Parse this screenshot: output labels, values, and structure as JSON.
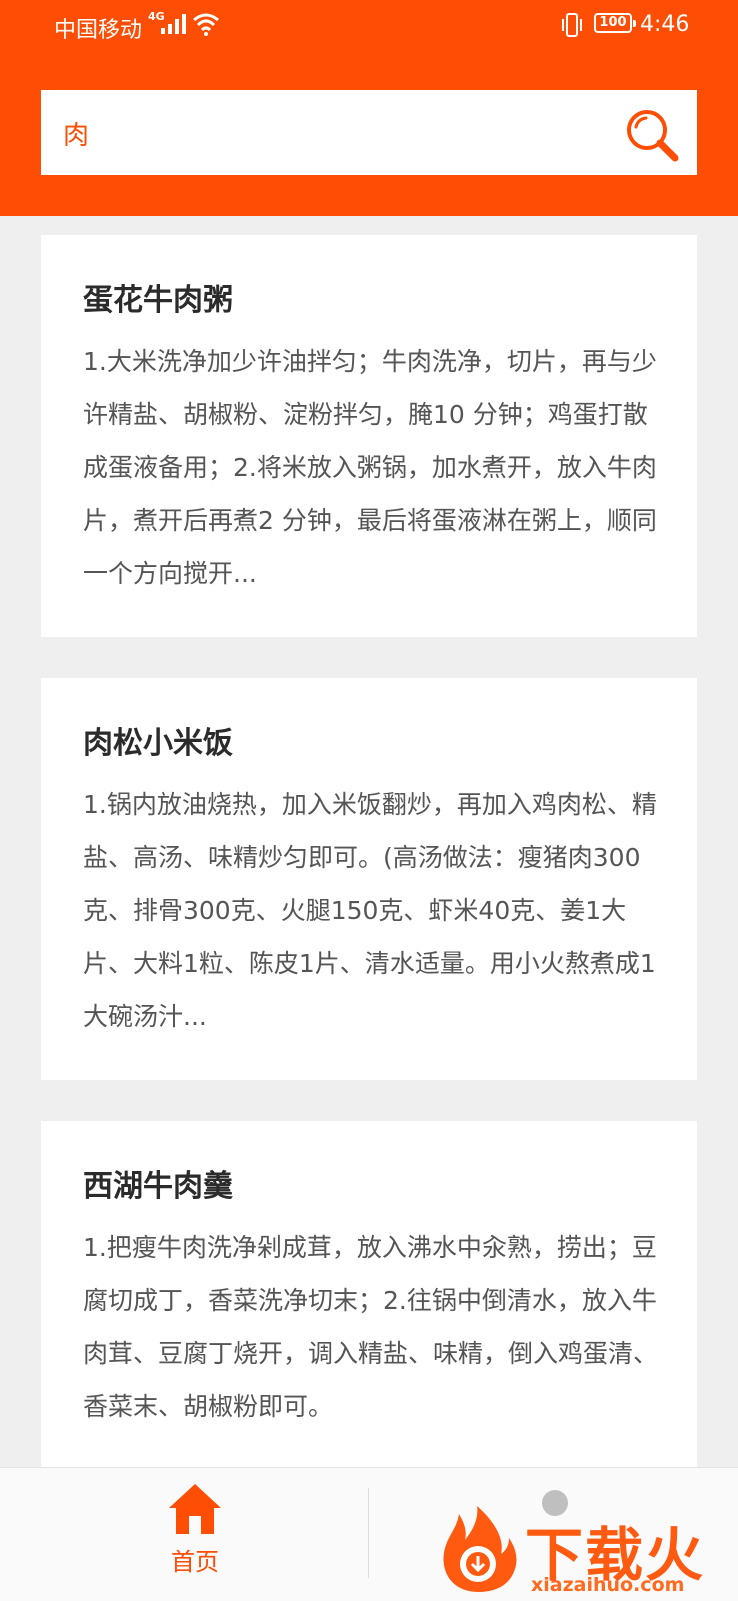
{
  "status_bar": {
    "carrier": "中国移动",
    "network": "4G",
    "battery": "100",
    "time": "4:46"
  },
  "search": {
    "query": "肉"
  },
  "results": [
    {
      "title": "蛋花牛肉粥",
      "summary": "1.大米洗净加少许油拌匀；牛肉洗净，切片，再与少许精盐、胡椒粉、淀粉拌匀，腌10 分钟；鸡蛋打散成蛋液备用；2.将米放入粥锅，加水煮开，放入牛肉片，煮开后再煮2 分钟，最后将蛋液淋在粥上，顺同一个方向搅开..."
    },
    {
      "title": "肉松小米饭",
      "summary": "1.锅内放油烧热，加入米饭翻炒，再加入鸡肉松、精盐、高汤、味精炒匀即可。(高汤做法：瘦猪肉300克、排骨300克、火腿150克、虾米40克、姜1大片、大料1粒、陈皮1片、清水适量。用小火熬煮成1大碗汤汁..."
    },
    {
      "title": "西湖牛肉羹",
      "summary": "1.把瘦牛肉洗净剁成茸，放入沸水中汆熟，捞出；豆腐切成丁，香菜洗净切末；2.往锅中倒清水，放入牛肉茸、豆腐丁烧开，调入精盐、味精，倒入鸡蛋清、香菜末、胡椒粉即可。"
    }
  ],
  "bottom_nav": {
    "home_label": "首页"
  },
  "watermark": {
    "brand": "下载火",
    "url": "xiazaihuo.com"
  },
  "colors": {
    "accent": "#fe4d04",
    "background": "#efefef",
    "card": "#ffffff"
  }
}
